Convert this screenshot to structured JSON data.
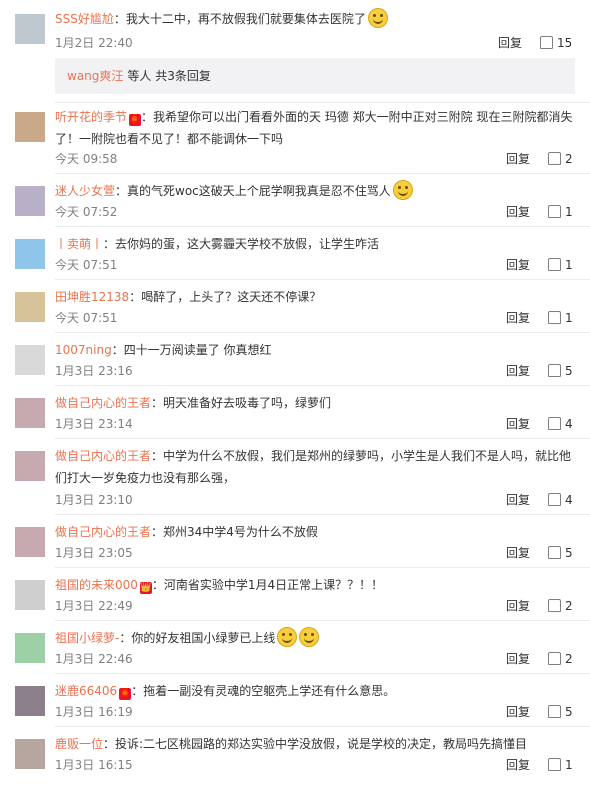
{
  "comments": [
    {
      "username": "SSS好尴尬",
      "badge": "",
      "text": "：我大十二中，再不放假我们就要集体去医院了",
      "emoji": "smiley-laugh-icon",
      "time": "1月2日 22:40",
      "reply_label": "回复",
      "likes": "15",
      "replies": {
        "name": "wang爽汪",
        "text": "等人 共3条回复"
      }
    },
    {
      "username": "听开花的季节",
      "badge": "🧧",
      "text": "：我希望你可以出门看看外面的天 玛德 郑大一附中正对三附院 现在三附院都消失了！一附院也看不见了！都不能调休一下吗",
      "emoji": "",
      "time": "今天 09:58",
      "reply_label": "回复",
      "likes": "2"
    },
    {
      "username": "迷人少女萱",
      "badge": "",
      "text": "：真的气死woc这破天上个屁学啊我真是忍不住骂人",
      "emoji": "smiley-icon",
      "time": "今天 07:52",
      "reply_label": "回复",
      "likes": "1"
    },
    {
      "username": "丨卖萌丨",
      "badge": "",
      "text": "：去你妈的蛋，这大雾霾天学校不放假，让学生咋活",
      "emoji": "",
      "time": "今天 07:51",
      "reply_label": "回复",
      "likes": "1"
    },
    {
      "username": "田坤胜12138",
      "badge": "",
      "text": "：喝醉了，上头了？这天还不停课？",
      "emoji": "",
      "time": "今天 07:51",
      "reply_label": "回复",
      "likes": "1"
    },
    {
      "username": "1007ning",
      "badge": "",
      "text": "：四十一万阅读量了 你真想红",
      "emoji": "",
      "time": "1月3日 23:16",
      "reply_label": "回复",
      "likes": "5"
    },
    {
      "username": "做自己内心的王者",
      "badge": "",
      "text": "：明天准备好去吸毒了吗，绿萝们",
      "emoji": "",
      "time": "1月3日 23:14",
      "reply_label": "回复",
      "likes": "4"
    },
    {
      "username": "做自己内心的王者",
      "badge": "",
      "text": "：中学为什么不放假，我们是郑州的绿萝吗，小学生是人我们不是人吗，就比他们打大一岁免疫力也没有那么强，",
      "emoji": "",
      "time": "1月3日 23:10",
      "reply_label": "回复",
      "likes": "4"
    },
    {
      "username": "做自己内心的王者",
      "badge": "",
      "text": "：郑州34中学4号为什么不放假",
      "emoji": "",
      "time": "1月3日 23:05",
      "reply_label": "回复",
      "likes": "5"
    },
    {
      "username": "祖国的未来000",
      "badge": "👑",
      "text": "：河南省实验中学1月4日正常上课？？！！",
      "emoji": "",
      "time": "1月3日 22:49",
      "reply_label": "回复",
      "likes": "2"
    },
    {
      "username": "祖国小绿萝-",
      "badge": "",
      "text": "：你的好友祖国小绿萝已上线",
      "emoji": "double-smiley-icon",
      "time": "1月3日 22:46",
      "reply_label": "回复",
      "likes": "2"
    },
    {
      "username": "迷鹿66406",
      "badge": "🧧",
      "text": "：拖着一副没有灵魂的空躯壳上学还有什么意思。",
      "emoji": "",
      "time": "1月3日 16:19",
      "reply_label": "回复",
      "likes": "5"
    },
    {
      "username": "鹿贩一位",
      "badge": "",
      "text": "：投诉:二七区桃园路的郑达实验中学没放假，说是学校的决定，教局吗先搞懂目",
      "emoji": "",
      "time": "1月3日 16:15",
      "reply_label": "回复",
      "likes": "1"
    }
  ],
  "colors": {
    "username": "#eb7350",
    "time": "#808080",
    "reply_box_bg": "#f2f2f5"
  }
}
